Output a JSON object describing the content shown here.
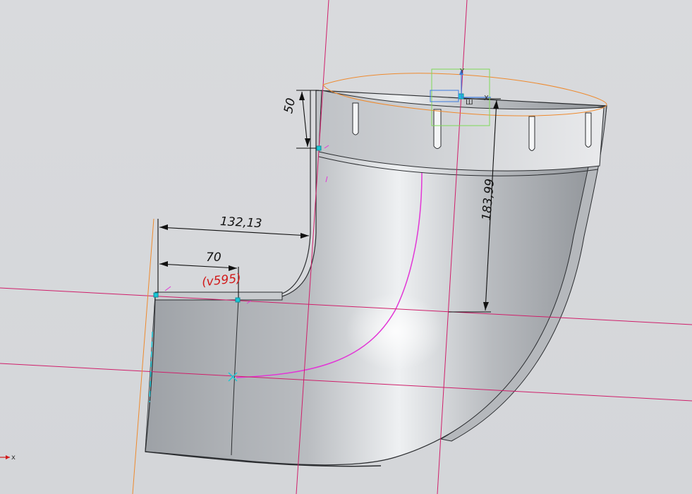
{
  "viewport": {
    "background_color": "#d7d9dc",
    "part_color": "#9a9ea3",
    "construction_line_color": "#cf1f6a",
    "sketch_curve_color": "#e236d6",
    "point_color": "#19c7d6",
    "dimension_color": "#111111",
    "driven_dimension_color": "#d11a1a"
  },
  "dimensions": {
    "d_132": "132,13",
    "d_70": "70",
    "d_v595": "(v595)",
    "d_50": "50",
    "d_183": "183,99"
  },
  "triad": {
    "x_label": "X",
    "y_label": "Y",
    "origin_label": "Ш"
  },
  "corner_axis": {
    "x_label": "x"
  }
}
